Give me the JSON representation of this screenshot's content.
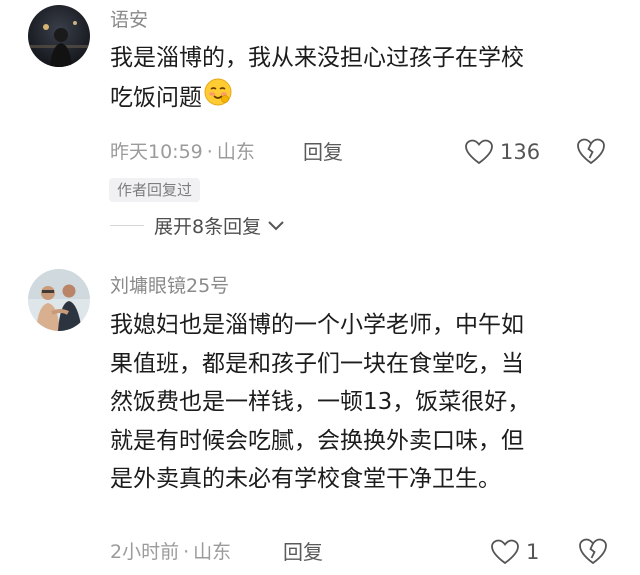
{
  "comments": [
    {
      "username": "语安",
      "lines": [
        "我是淄博的，我从来没担心过孩子在学校",
        "吃饭问题"
      ],
      "emoji_icon": "blush-smile-emoji",
      "time": "昨天10:59",
      "separator": "·",
      "location": "山东",
      "reply_label": "回复",
      "like_count": "136",
      "author_badge": "作者回复过",
      "expand_label": "展开8条回复"
    },
    {
      "username": "刘墉眼镜25号",
      "lines": [
        "我媳妇也是淄博的一个小学老师，中午如",
        "果值班，都是和孩子们一块在食堂吃，当",
        "然饭费也是一样钱，一顿13，饭菜很好，",
        "就是有时候会吃腻，会换换外卖口味，但",
        "是外卖真的未必有学校食堂干净卫生。"
      ],
      "time": "2小时前",
      "separator": "·",
      "location": "山东",
      "reply_label": "回复",
      "like_count": "1"
    }
  ],
  "icons": {
    "like": "heart-outline-icon",
    "dislike": "broken-heart-icon",
    "expand": "chevron-down-icon"
  },
  "colors": {
    "meta_gray": "#9b9b9b",
    "text": "#1c1c1c",
    "badge_bg": "#f1f1f3"
  }
}
